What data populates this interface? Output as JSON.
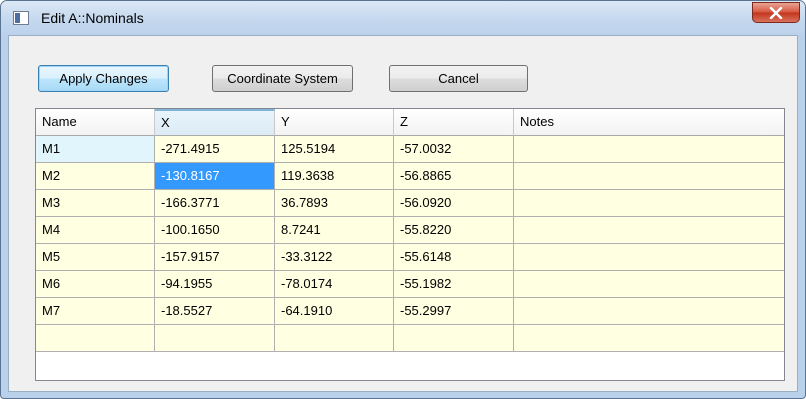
{
  "window": {
    "title": "Edit A::Nominals",
    "icon": "window-app-icon",
    "close_icon": "close-icon"
  },
  "toolbar": {
    "apply_label": "Apply Changes",
    "coord_label": "Coordinate System",
    "cancel_label": "Cancel"
  },
  "table": {
    "columns": [
      "Name",
      "X",
      "Y",
      "Z",
      "Notes"
    ],
    "rows": [
      {
        "name": "M1",
        "x": "-271.4915",
        "y": "125.5194",
        "z": "-57.0032",
        "notes": ""
      },
      {
        "name": "M2",
        "x": "-130.8167",
        "y": "119.3638",
        "z": "-56.8865",
        "notes": ""
      },
      {
        "name": "M3",
        "x": "-166.3771",
        "y": "36.7893",
        "z": "-56.0920",
        "notes": ""
      },
      {
        "name": "M4",
        "x": "-100.1650",
        "y": "8.7241",
        "z": "-55.8220",
        "notes": ""
      },
      {
        "name": "M5",
        "x": "-157.9157",
        "y": "-33.3122",
        "z": "-55.6148",
        "notes": ""
      },
      {
        "name": "M6",
        "x": "-94.1955",
        "y": "-78.0174",
        "z": "-55.1982",
        "notes": ""
      },
      {
        "name": "M7",
        "x": "-18.5527",
        "y": "-64.1910",
        "z": "-55.2997",
        "notes": ""
      }
    ],
    "selected_cell": "M2 / X"
  },
  "colors": {
    "cell_background": "#ffffe1",
    "selection": "#3399ff",
    "close_button": "#c3341c"
  }
}
